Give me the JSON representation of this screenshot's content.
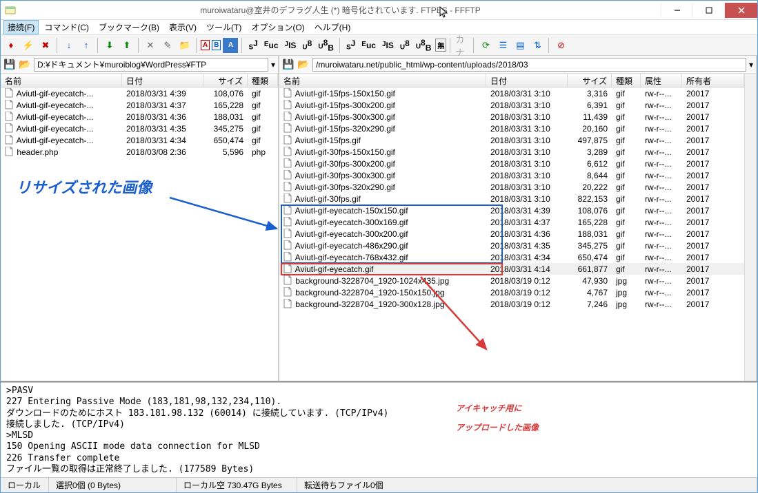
{
  "window": {
    "title": "muroiwataru@室井のデフラグ人生 (*) 暗号化されています. FTPES - FFFTP"
  },
  "menu": {
    "connect": "接続(F)",
    "command": "コマンド(C)",
    "bookmark": "ブックマーク(B)",
    "view": "表示(V)",
    "tool": "ツール(T)",
    "option": "オプション(O)",
    "help": "ヘルプ(H)"
  },
  "local": {
    "path": "D:¥ドキュメント¥muroiblog¥WordPress¥FTP",
    "headers": {
      "name": "名前",
      "date": "日付",
      "size": "サイズ",
      "type": "種類"
    },
    "rows": [
      {
        "name": "Aviutl-gif-eyecatch-...",
        "date": "2018/03/31 4:39",
        "size": "108,076",
        "type": "gif"
      },
      {
        "name": "Aviutl-gif-eyecatch-...",
        "date": "2018/03/31 4:37",
        "size": "165,228",
        "type": "gif"
      },
      {
        "name": "Aviutl-gif-eyecatch-...",
        "date": "2018/03/31 4:36",
        "size": "188,031",
        "type": "gif"
      },
      {
        "name": "Aviutl-gif-eyecatch-...",
        "date": "2018/03/31 4:35",
        "size": "345,275",
        "type": "gif"
      },
      {
        "name": "Aviutl-gif-eyecatch-...",
        "date": "2018/03/31 4:34",
        "size": "650,474",
        "type": "gif"
      },
      {
        "name": "header.php",
        "date": "2018/03/08 2:36",
        "size": "5,596",
        "type": "php"
      }
    ]
  },
  "remote": {
    "path": "/muroiwataru.net/public_html/wp-content/uploads/2018/03",
    "headers": {
      "name": "名前",
      "date": "日付",
      "size": "サイズ",
      "type": "種類",
      "perm": "属性",
      "owner": "所有者"
    },
    "rows": [
      {
        "name": "Aviutl-gif-15fps-150x150.gif",
        "date": "2018/03/31 3:10",
        "size": "3,316",
        "type": "gif",
        "perm": "rw-r--...",
        "owner": "20017"
      },
      {
        "name": "Aviutl-gif-15fps-300x200.gif",
        "date": "2018/03/31 3:10",
        "size": "6,391",
        "type": "gif",
        "perm": "rw-r--...",
        "owner": "20017"
      },
      {
        "name": "Aviutl-gif-15fps-300x300.gif",
        "date": "2018/03/31 3:10",
        "size": "11,439",
        "type": "gif",
        "perm": "rw-r--...",
        "owner": "20017"
      },
      {
        "name": "Aviutl-gif-15fps-320x290.gif",
        "date": "2018/03/31 3:10",
        "size": "20,160",
        "type": "gif",
        "perm": "rw-r--...",
        "owner": "20017"
      },
      {
        "name": "Aviutl-gif-15fps.gif",
        "date": "2018/03/31 3:10",
        "size": "497,875",
        "type": "gif",
        "perm": "rw-r--...",
        "owner": "20017"
      },
      {
        "name": "Aviutl-gif-30fps-150x150.gif",
        "date": "2018/03/31 3:10",
        "size": "3,289",
        "type": "gif",
        "perm": "rw-r--...",
        "owner": "20017"
      },
      {
        "name": "Aviutl-gif-30fps-300x200.gif",
        "date": "2018/03/31 3:10",
        "size": "6,612",
        "type": "gif",
        "perm": "rw-r--...",
        "owner": "20017"
      },
      {
        "name": "Aviutl-gif-30fps-300x300.gif",
        "date": "2018/03/31 3:10",
        "size": "8,644",
        "type": "gif",
        "perm": "rw-r--...",
        "owner": "20017"
      },
      {
        "name": "Aviutl-gif-30fps-320x290.gif",
        "date": "2018/03/31 3:10",
        "size": "20,222",
        "type": "gif",
        "perm": "rw-r--...",
        "owner": "20017"
      },
      {
        "name": "Aviutl-gif-30fps.gif",
        "date": "2018/03/31 3:10",
        "size": "822,153",
        "type": "gif",
        "perm": "rw-r--...",
        "owner": "20017"
      },
      {
        "name": "Aviutl-gif-eyecatch-150x150.gif",
        "date": "2018/03/31 4:39",
        "size": "108,076",
        "type": "gif",
        "perm": "rw-r--...",
        "owner": "20017"
      },
      {
        "name": "Aviutl-gif-eyecatch-300x169.gif",
        "date": "2018/03/31 4:37",
        "size": "165,228",
        "type": "gif",
        "perm": "rw-r--...",
        "owner": "20017"
      },
      {
        "name": "Aviutl-gif-eyecatch-300x200.gif",
        "date": "2018/03/31 4:36",
        "size": "188,031",
        "type": "gif",
        "perm": "rw-r--...",
        "owner": "20017"
      },
      {
        "name": "Aviutl-gif-eyecatch-486x290.gif",
        "date": "2018/03/31 4:35",
        "size": "345,275",
        "type": "gif",
        "perm": "rw-r--...",
        "owner": "20017"
      },
      {
        "name": "Aviutl-gif-eyecatch-768x432.gif",
        "date": "2018/03/31 4:34",
        "size": "650,474",
        "type": "gif",
        "perm": "rw-r--...",
        "owner": "20017"
      },
      {
        "name": "Aviutl-gif-eyecatch.gif",
        "date": "2018/03/31 4:14",
        "size": "661,877",
        "type": "gif",
        "perm": "rw-r--...",
        "owner": "20017",
        "selected": true
      },
      {
        "name": "background-3228704_1920-1024x435.jpg",
        "date": "2018/03/19 0:12",
        "size": "47,930",
        "type": "jpg",
        "perm": "rw-r--...",
        "owner": "20017"
      },
      {
        "name": "background-3228704_1920-150x150.jpg",
        "date": "2018/03/19 0:12",
        "size": "4,767",
        "type": "jpg",
        "perm": "rw-r--...",
        "owner": "20017"
      },
      {
        "name": "background-3228704_1920-300x128.jpg",
        "date": "2018/03/19 0:12",
        "size": "7,246",
        "type": "jpg",
        "perm": "rw-r--...",
        "owner": "20017"
      }
    ]
  },
  "annotations": {
    "blue": "リサイズされた画像",
    "red_line1": "アイキャッチ用に",
    "red_line2": "アップロードした画像"
  },
  "log_lines": [
    ">PASV",
    "227 Entering Passive Mode (183,181,98,132,234,110).",
    "ダウンロードのためにホスト 183.181.98.132 (60014) に接続しています. (TCP/IPv4)",
    "接続しました. (TCP/IPv4)",
    ">MLSD",
    "150 Opening ASCII mode data connection for MLSD",
    "226 Transfer complete",
    "ファイル一覧の取得は正常終了しました. (177589 Bytes)"
  ],
  "status": {
    "local": "ローカル",
    "selection": "選択0個 (0 Bytes)",
    "free": "ローカル空 730.47G Bytes",
    "queue": "転送待ちファイル0個"
  }
}
